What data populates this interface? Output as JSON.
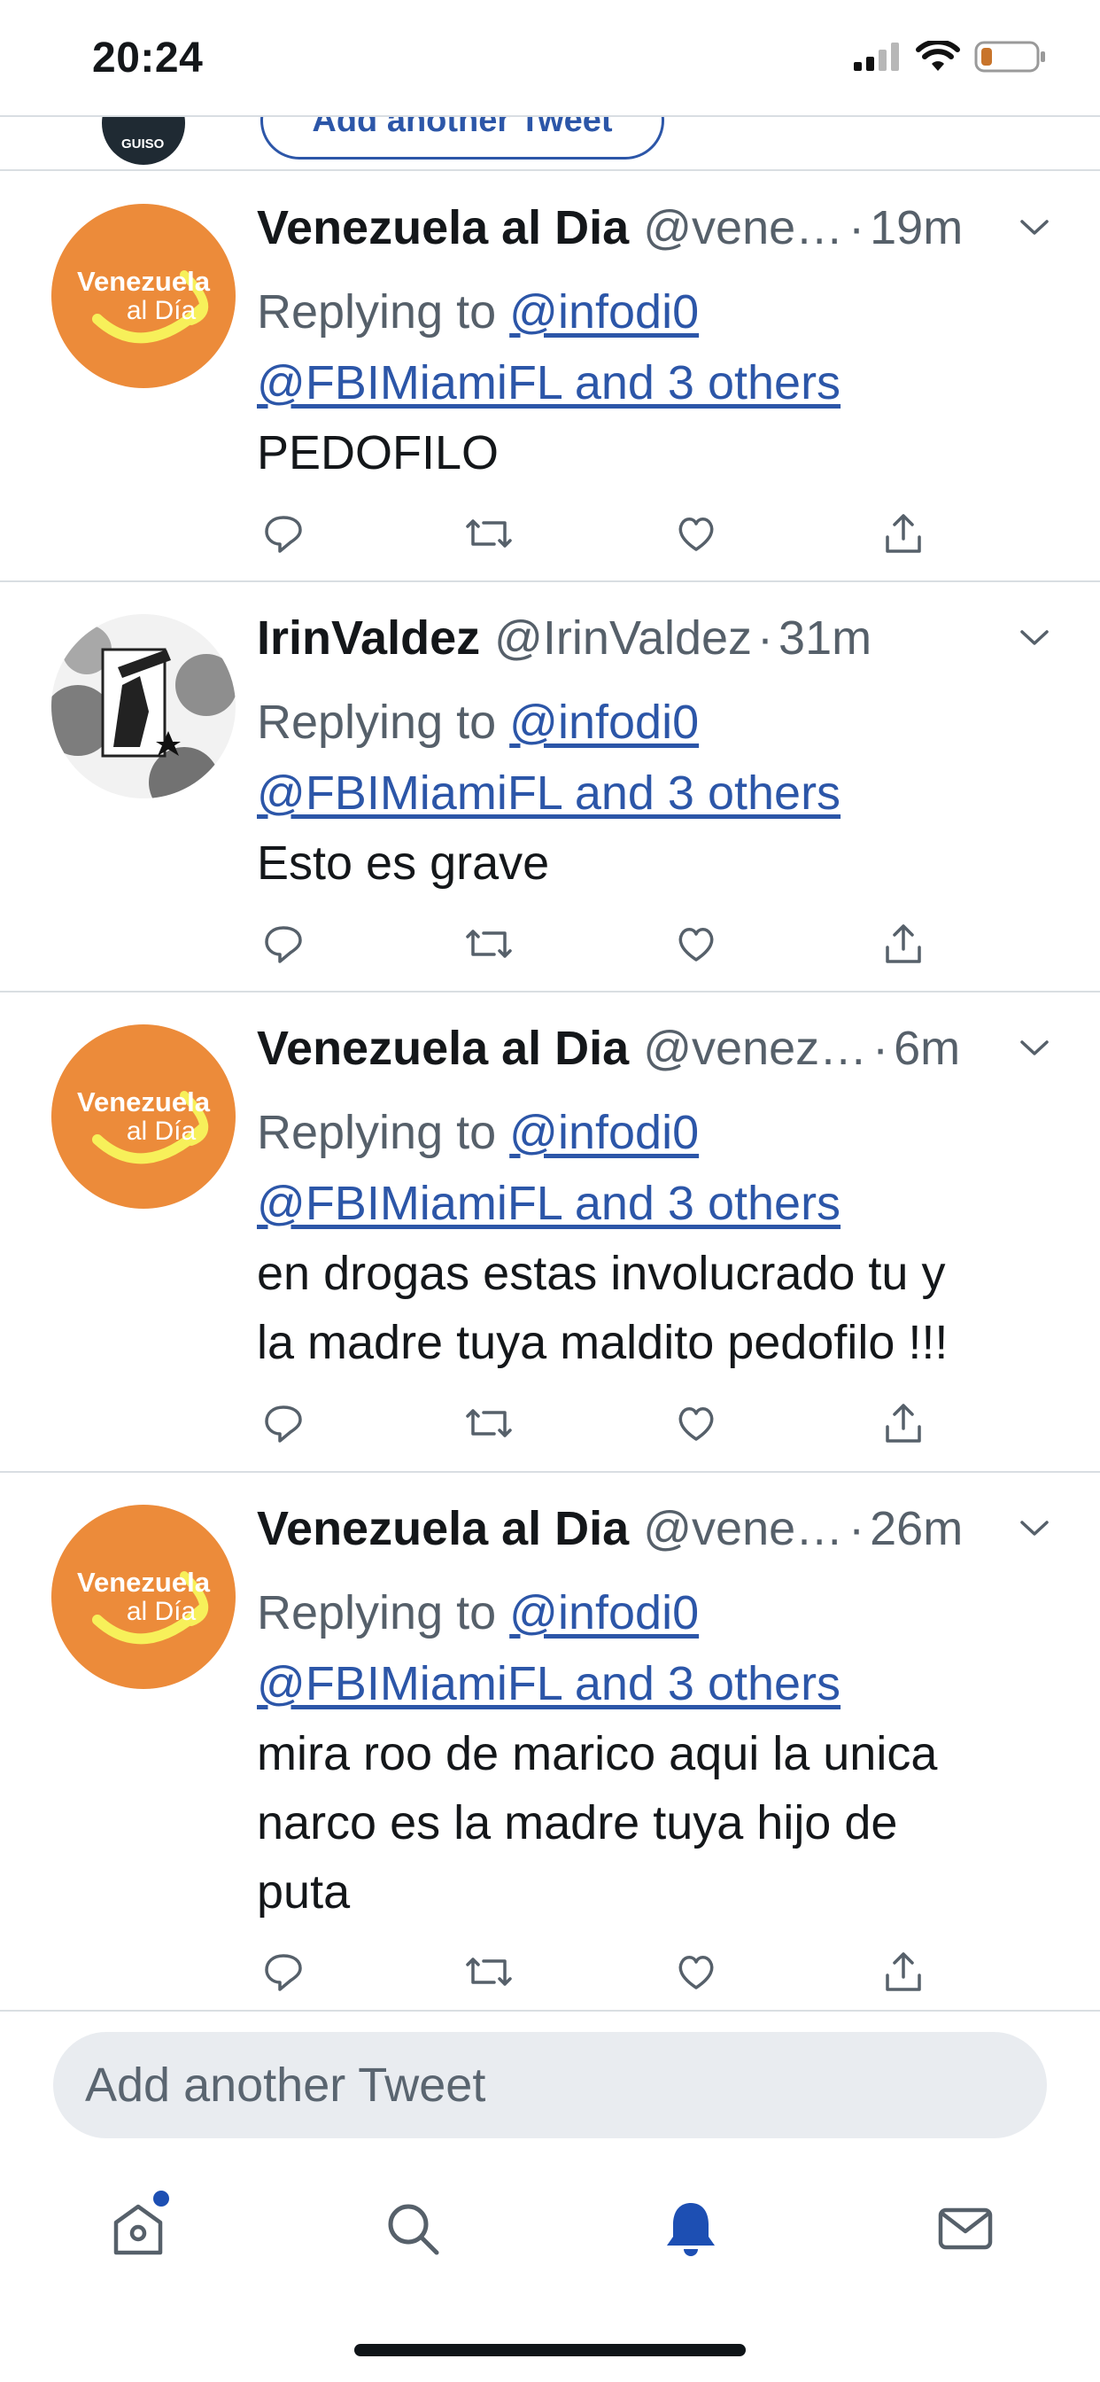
{
  "status_bar": {
    "time": "20:24"
  },
  "partial_row": {
    "avatar_text": "GUISO",
    "button_label": "Add another Tweet"
  },
  "tweets": [
    {
      "name": "Venezuela al Dia",
      "handle": "@vene…",
      "time": "19m",
      "replying_prefix": "Replying to ",
      "reply_user": "@infodi0",
      "reply_others": "@FBIMiamiFL and 3 others",
      "text": "PEDOFILO",
      "avatar_text_line1": "Venezuela",
      "avatar_text_line2": "al Día"
    },
    {
      "name": "IrinValdez",
      "handle": "@IrinValdez",
      "time": "31m",
      "replying_prefix": "Replying to ",
      "reply_user": "@infodi0",
      "reply_others": "@FBIMiamiFL and 3 others",
      "text": "Esto es grave"
    },
    {
      "name": "Venezuela al Dia",
      "handle": "@venez…",
      "time": "6m",
      "replying_prefix": "Replying to ",
      "reply_user": "@infodi0",
      "reply_others": "@FBIMiamiFL and 3 others",
      "text_line1": "en drogas estas involucrado tu y",
      "text_line2": "la madre tuya maldito pedofilo !!!",
      "avatar_text_line1": "Venezuela",
      "avatar_text_line2": "al Día"
    },
    {
      "name": "Venezuela al Dia",
      "handle": "@vene…",
      "time": "26m",
      "replying_prefix": "Replying to ",
      "reply_user": "@infodi0",
      "reply_others": "@FBIMiamiFL and 3 others",
      "text_line1": "mira roo de marico aqui la unica",
      "text_line2": "narco es la madre tuya hijo de",
      "text_line3": "puta",
      "avatar_text_line1": "Venezuela",
      "avatar_text_line2": "al Día"
    }
  ],
  "composer": {
    "placeholder": "Add another Tweet"
  },
  "tabbar": {
    "items": [
      {
        "icon": "home-icon",
        "has_badge": true
      },
      {
        "icon": "search-icon"
      },
      {
        "icon": "notifications-bell-icon",
        "active": true
      },
      {
        "icon": "messages-mail-icon"
      }
    ]
  },
  "colors": {
    "link_blue": "#2c56a8",
    "muted_text": "#56606a",
    "avatar_orange": "#ec8b3a",
    "avatar_yellow_swoosh": "#f7f05a",
    "active_tab_blue": "#1d4fb3"
  }
}
